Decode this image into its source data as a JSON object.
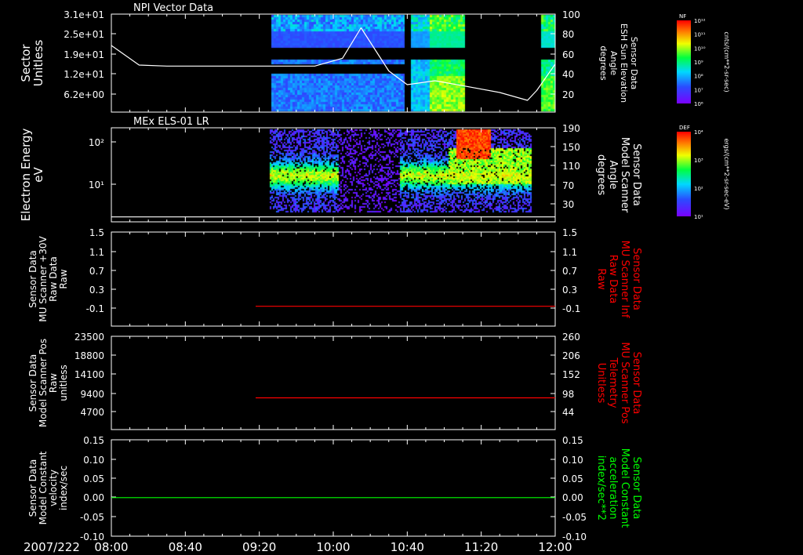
{
  "chart_data": {
    "date_label": "2007/222",
    "x_ticks": [
      "08:00",
      "08:40",
      "09:20",
      "10:00",
      "10:40",
      "11:20",
      "12:00"
    ],
    "panels": [
      {
        "title": "NPI Vector Data",
        "type": "heatmap",
        "ylabel_left": [
          "Sector",
          "Unitless"
        ],
        "yticks_left": [
          "3.1e+01",
          "2.5e+01",
          "1.9e+01",
          "1.2e+01",
          "6.2e+00"
        ],
        "ylabel_right": [
          "Sensor Data",
          "ESH Sun Elevation",
          "Angle",
          "degrees"
        ],
        "yticks_right": [
          "100",
          "80",
          "60",
          "40",
          "20"
        ],
        "ylim_right": [
          0,
          100
        ],
        "line_color": "#ffffff",
        "line": {
          "x": [
            "08:00",
            "08:15",
            "08:30",
            "09:00",
            "09:30",
            "09:50",
            "10:05",
            "10:15",
            "10:30",
            "10:40",
            "10:55",
            "11:10",
            "11:30",
            "11:45",
            "11:50",
            "12:00"
          ],
          "y": [
            68,
            48,
            47,
            47,
            47,
            47,
            55,
            86,
            42,
            28,
            32,
            27,
            20,
            12,
            22,
            49
          ]
        },
        "colorbar": {
          "label": "NF",
          "unit": "cnts/(cm**2-sr-sec)",
          "ticks": [
            "10¹²",
            "10¹¹",
            "10¹⁰",
            "10⁹",
            "10⁸",
            "10⁷",
            "10⁶"
          ]
        }
      },
      {
        "title": "MEx ELS-01 LR",
        "type": "heatmap",
        "ylabel_left": [
          "Electron Energy",
          "eV"
        ],
        "yticks_left": [
          "10²",
          "10¹"
        ],
        "ylabel_right": [
          "Sensor Data",
          "Model Scanner",
          "Angle",
          "degrees"
        ],
        "yticks_right": [
          "190",
          "150",
          "110",
          "70",
          "30"
        ],
        "ylim_right": [
          0,
          190
        ],
        "line_color": "#ffffff",
        "line": {
          "x": [
            "08:00",
            "12:00"
          ],
          "y": [
            10,
            10
          ]
        },
        "colorbar": {
          "label": "DEF",
          "unit": "ergs/(cm**2-sr-sec-eV)",
          "ticks": [
            "10⁴",
            "10³",
            "10²",
            "10¹"
          ]
        }
      },
      {
        "type": "line",
        "ylabel_left": [
          "Sensor Data",
          "MU Scanner +30V",
          "Raw Data",
          "Raw"
        ],
        "yticks_left": [
          "1.5",
          "1.1",
          "0.7",
          "0.3",
          "-0.1"
        ],
        "ylabel_right": [
          "Sensor Data",
          "MU Scanner Inf",
          "Raw Data",
          "Raw"
        ],
        "right_label_color": "#ff0000",
        "yticks_right": [
          "1.5",
          "1.1",
          "0.7",
          "0.3",
          "-0.1"
        ],
        "ylim": [
          -0.4,
          1.5
        ],
        "line_color": "#ff0000",
        "line": {
          "x": [
            "09:18",
            "12:00"
          ],
          "y": [
            0.0,
            0.0
          ]
        }
      },
      {
        "type": "line",
        "ylabel_left": [
          "Sensor Data",
          "Model Scanner Pos",
          "Raw",
          "unitless"
        ],
        "yticks_left": [
          "23500",
          "18800",
          "14100",
          "9400",
          "4700"
        ],
        "ylabel_right": [
          "Sensor Data",
          "MU Scanner Pos",
          "Telemetry",
          "Unitless"
        ],
        "right_label_color": "#ff0000",
        "yticks_right": [
          "260",
          "206",
          "152",
          "98",
          "44"
        ],
        "ylim": [
          0,
          23500
        ],
        "line_color": "#ff0000",
        "line": {
          "x": [
            "09:18",
            "12:00"
          ],
          "y": [
            8000,
            8000
          ]
        }
      },
      {
        "type": "line",
        "ylabel_left": [
          "Sensor Data",
          "Model Constant",
          "velocity",
          "index/sec"
        ],
        "yticks_left": [
          "0.15",
          "0.10",
          "0.05",
          "0.00",
          "-0.05",
          "-0.10"
        ],
        "ylabel_right": [
          "Sensor Data",
          "Model Constant",
          "acceleration",
          "index/sec**2"
        ],
        "right_label_color": "#00ff00",
        "yticks_right": [
          "0.15",
          "0.10",
          "0.05",
          "0.00",
          "-0.05",
          "-0.10"
        ],
        "ylim": [
          -0.1,
          0.15
        ],
        "line_color": "#00ff00",
        "line": {
          "x": [
            "08:00",
            "12:00"
          ],
          "y": [
            0.0,
            0.0
          ]
        }
      }
    ]
  }
}
